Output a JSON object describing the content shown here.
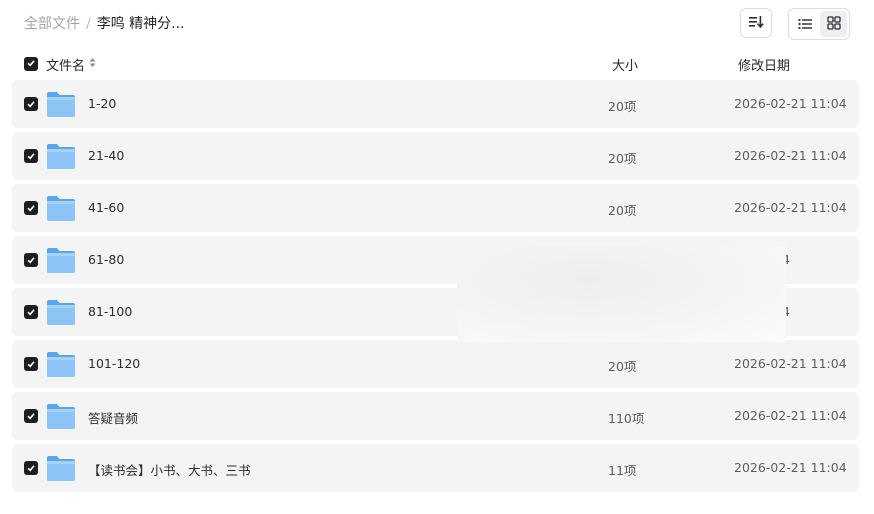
{
  "breadcrumb": {
    "root": "全部文件",
    "separator": "/",
    "current": "李鸣 精神分..."
  },
  "header": {
    "name_label": "文件名",
    "size_label": "大小",
    "date_label": "修改日期"
  },
  "icons": {
    "sort": "sort-descending-icon",
    "list_view": "list-view-icon",
    "grid_view": "grid-view-icon",
    "sort_column": "sort-arrows-icon",
    "checkbox": "checkmark-icon",
    "folder": "folder-icon"
  },
  "colors": {
    "folder": "#6fb2ee",
    "checkbox": "#1d1e22",
    "row_bg": "#f4f4f5"
  },
  "view_mode": "list",
  "rows": [
    {
      "name": "1-20",
      "size": "20项",
      "date": "2026-02-21 11:04",
      "checked": true
    },
    {
      "name": "21-40",
      "size": "20项",
      "date": "2026-02-21 11:04",
      "checked": true
    },
    {
      "name": "41-60",
      "size": "20项",
      "date": "2026-02-21 11:04",
      "checked": true
    },
    {
      "name": "61-80",
      "size": "",
      "date": "21 11:04",
      "checked": true
    },
    {
      "name": "81-100",
      "size": "",
      "date": "21 11:04",
      "checked": true
    },
    {
      "name": "101-120",
      "size": "20项",
      "date": "2026-02-21 11:04",
      "checked": true
    },
    {
      "name": "答疑音频",
      "size": "110项",
      "date": "2026-02-21 11:04",
      "checked": true
    },
    {
      "name": "【读书会】小书、大书、三书",
      "size": "11项",
      "date": "2026-02-21 11:04",
      "checked": true
    }
  ]
}
